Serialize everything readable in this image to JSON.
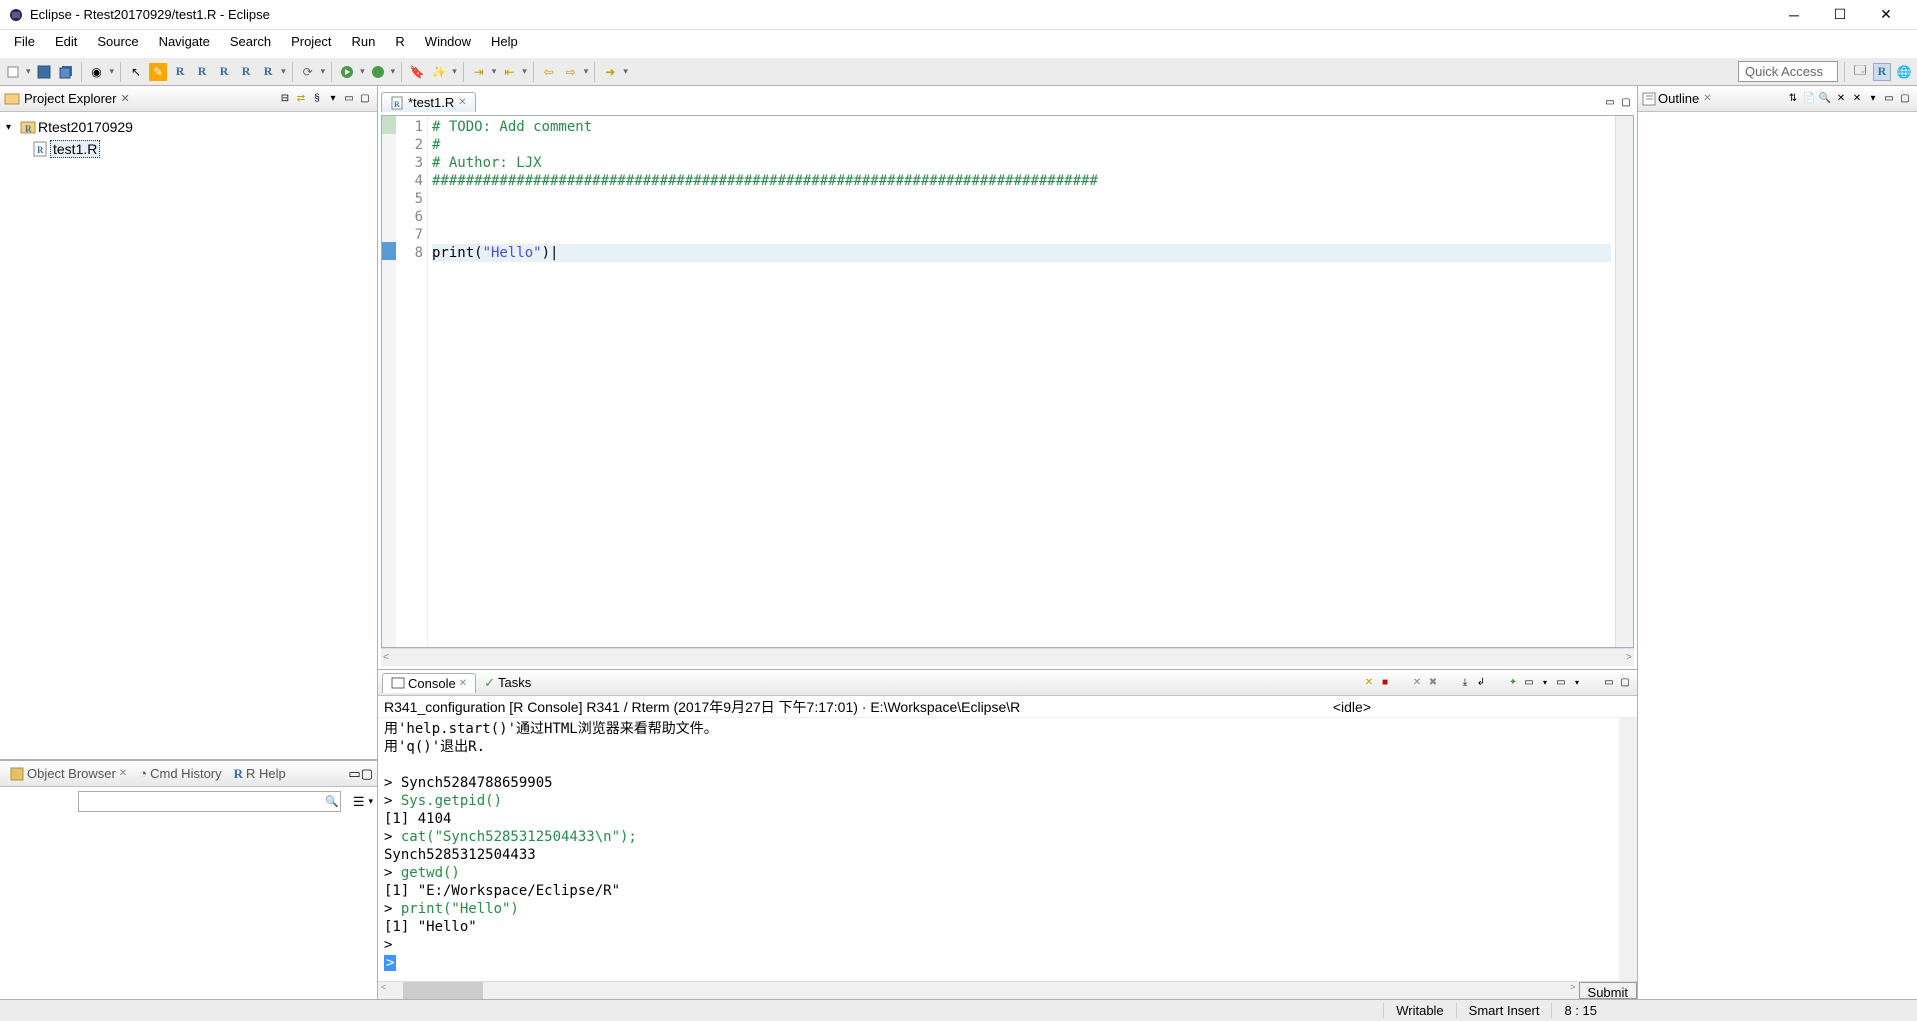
{
  "title": "Eclipse - Rtest20170929/test1.R - Eclipse",
  "menu": [
    "File",
    "Edit",
    "Source",
    "Navigate",
    "Search",
    "Project",
    "Run",
    "R",
    "Window",
    "Help"
  ],
  "quick_access": "Quick Access",
  "project_explorer": {
    "title": "Project Explorer",
    "project": "Rtest20170929",
    "file": "test1.R"
  },
  "editor": {
    "tab": "*test1.R",
    "lines": [
      {
        "n": 1,
        "type": "comment",
        "text": "# TODO: Add comment"
      },
      {
        "n": 2,
        "type": "comment",
        "text": "#"
      },
      {
        "n": 3,
        "type": "comment",
        "text": "# Author: LJX"
      },
      {
        "n": 4,
        "type": "comment",
        "text": "###############################################################################"
      },
      {
        "n": 5,
        "type": "plain",
        "text": ""
      },
      {
        "n": 6,
        "type": "plain",
        "text": ""
      },
      {
        "n": 7,
        "type": "plain",
        "text": ""
      },
      {
        "n": 8,
        "type": "code",
        "text": "print(\"Hello\")"
      }
    ],
    "current_line": 8
  },
  "console": {
    "tab_console": "Console",
    "tab_tasks": "Tasks",
    "info": "R341_configuration [R Console] R341 / Rterm (2017年9月27日 下午7:17:01)  ·  E:\\Workspace\\Eclipse\\R",
    "status": "<idle>",
    "lines": [
      {
        "t": "plain",
        "x": "用'help.start()'通过HTML浏览器来看帮助文件。"
      },
      {
        "t": "plain",
        "x": "用'q()'退出R."
      },
      {
        "t": "plain",
        "x": ""
      },
      {
        "t": "plain",
        "x": "> Synch5284788659905"
      },
      {
        "t": "cmd",
        "x": "> ",
        "c": "Sys.getpid()"
      },
      {
        "t": "plain",
        "x": "[1] 4104"
      },
      {
        "t": "cmd",
        "x": "> ",
        "c": "cat(\"Synch5285312504433\\n\");"
      },
      {
        "t": "plain",
        "x": "Synch5285312504433"
      },
      {
        "t": "cmd",
        "x": "> ",
        "c": "getwd()"
      },
      {
        "t": "plain",
        "x": "[1] \"E:/Workspace/Eclipse/R\""
      },
      {
        "t": "cmd",
        "x": "> ",
        "c": "print(\"Hello\")"
      },
      {
        "t": "plain",
        "x": "[1] \"Hello\""
      },
      {
        "t": "plain",
        "x": ">"
      }
    ],
    "submit": "Submit"
  },
  "outline": {
    "title": "Outline"
  },
  "object_browser": {
    "tab_ob": "Object Browser",
    "tab_cmd": "Cmd History",
    "tab_help": "R Help"
  },
  "statusbar": {
    "writable": "Writable",
    "insert": "Smart Insert",
    "pos": "8 : 15"
  }
}
